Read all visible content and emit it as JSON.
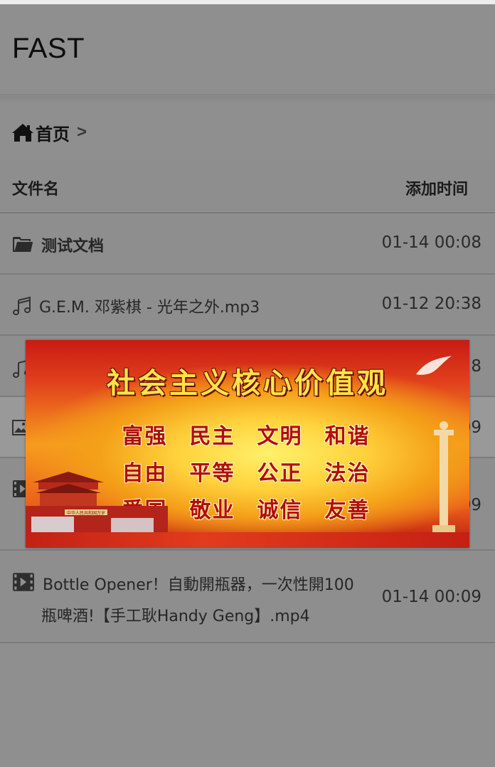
{
  "app": {
    "brand": "FAST"
  },
  "breadcrumb": {
    "home_label": "首页",
    "separator": ">"
  },
  "table": {
    "headers": {
      "name": "文件名",
      "time": "添加时间"
    },
    "rows": [
      {
        "type": "folder",
        "name": "测试文档",
        "time": "01-14 00:08"
      },
      {
        "type": "audio",
        "name": "G.E.M. 邓紫棋 - 光年之外.mp3",
        "time": "01-12 20:38"
      },
      {
        "type": "audio",
        "name": "",
        "time": "28"
      },
      {
        "type": "image",
        "name": "",
        "time": "09"
      },
      {
        "type": "video",
        "name": "",
        "time": "09"
      },
      {
        "type": "video",
        "name_line1": "Bottle Opener！自動開瓶器，一次性開100",
        "name_line2": "瓶啤酒!【手工耿Handy Geng】.mp4",
        "time": "01-14 00:09"
      }
    ]
  },
  "banner": {
    "title": "社会主义核心价值观",
    "values": [
      "富强",
      "民主",
      "文明",
      "和谐",
      "自由",
      "平等",
      "公正",
      "法治",
      "爱国",
      "敬业",
      "诚信",
      "友善"
    ],
    "gate_caption": "中华人民共和国万岁"
  }
}
